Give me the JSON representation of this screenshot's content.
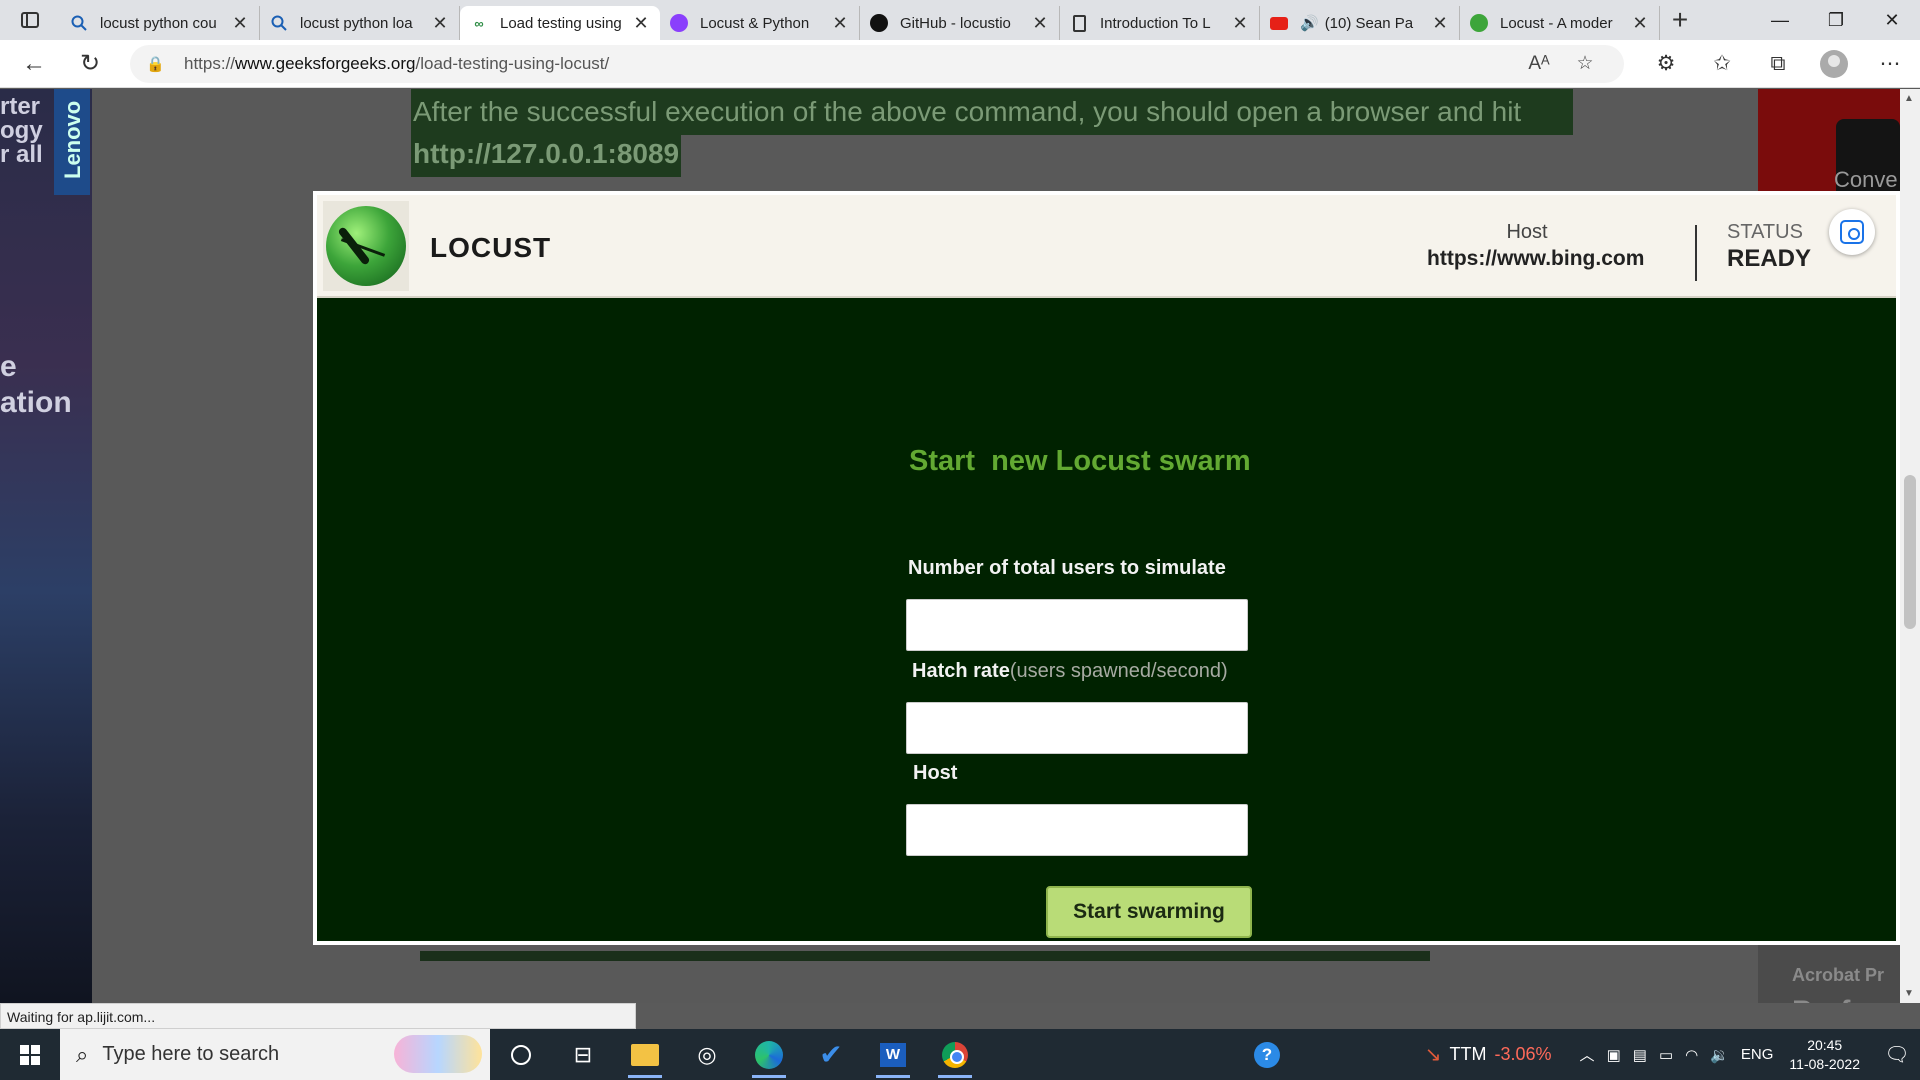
{
  "browser": {
    "tabs": [
      {
        "title": "locust python cou",
        "icon": "search-icon"
      },
      {
        "title": "locust python loa",
        "icon": "search-icon"
      },
      {
        "title": "Load testing using",
        "icon": "geeksforgeeks-icon"
      },
      {
        "title": "Locust & Python",
        "icon": "purple-app-icon"
      },
      {
        "title": "GitHub - locustio",
        "icon": "github-icon"
      },
      {
        "title": "Introduction To L",
        "icon": "document-icon"
      },
      {
        "title": "(10) Sean Pa",
        "icon": "youtube-icon"
      },
      {
        "title": "Locust - A moder",
        "icon": "locust-icon"
      }
    ],
    "active_tab_index": 2,
    "address": {
      "prefix": "https://",
      "domain": "www.geeksforgeeks.org",
      "path": "/load-testing-using-locust/"
    },
    "status_text": "Waiting for ap.lijit.com..."
  },
  "article": {
    "line1": "After the successful execution of the above command, you should open a browser and hit",
    "line2": "http://127.0.0.1:8089"
  },
  "ads": {
    "left_text_top": "rter\nogy\nr all",
    "left_brand": "Lenovo",
    "left_text_mid": "e\nation",
    "right_text_top": "Conve",
    "right_text_bottom1": "Acrobat Pr",
    "right_text_bottom2": "Perfo"
  },
  "locust": {
    "brand": "LOCUST",
    "host_label": "Host",
    "host_value": "https://www.bing.com",
    "status_label": "STATUS",
    "status_value": "READY",
    "title": "Start  new Locust swarm",
    "users_label": "Number of total users to simulate",
    "hatch_label": "Hatch rate",
    "hatch_hint": "(users spawned/second)",
    "host_field_label": "Host",
    "users_value": "",
    "hatch_value": "",
    "host_field_value": "",
    "button_label": "Start swarming"
  },
  "taskbar": {
    "search_placeholder": "Type here to search",
    "stock_symbol": "TTM",
    "stock_change": "-3.06%",
    "language": "ENG",
    "time": "20:45",
    "date": "11-08-2022"
  }
}
